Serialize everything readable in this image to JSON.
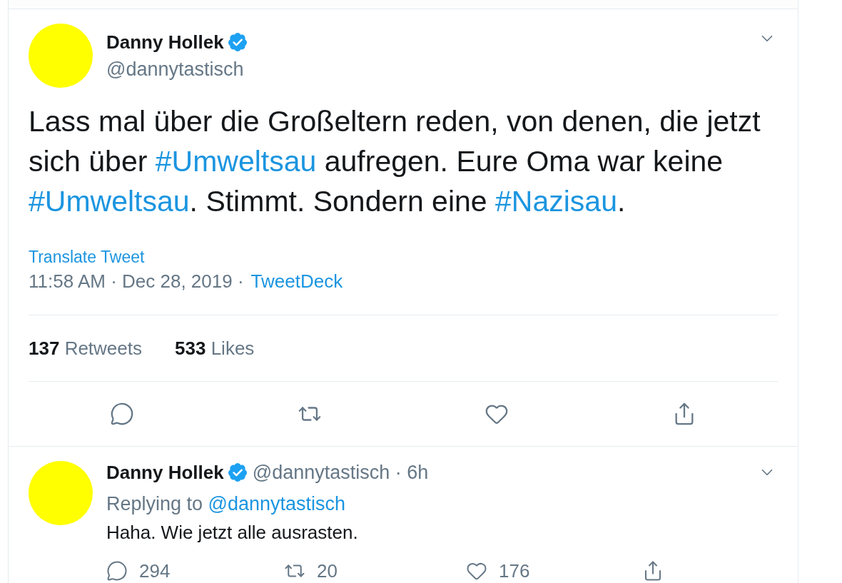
{
  "tweet": {
    "author": {
      "name": "Danny Hollek",
      "verified": true,
      "handle": "@dannytastisch"
    },
    "text": [
      {
        "kind": "plain",
        "text": "Lass mal über die Großeltern reden, von denen, die jetzt sich über "
      },
      {
        "kind": "hashtag",
        "text": "#Umweltsau"
      },
      {
        "kind": "plain",
        "text": " aufregen. Eure Oma war keine "
      },
      {
        "kind": "hashtag",
        "text": "#Umweltsau"
      },
      {
        "kind": "plain",
        "text": ". Stimmt. Sondern eine "
      },
      {
        "kind": "hashtag",
        "text": "#Nazisau"
      },
      {
        "kind": "plain",
        "text": "."
      }
    ],
    "translate": "Translate Tweet",
    "timestamp": "11:58 AM · Dec 28, 2019 ·",
    "source": "TweetDeck",
    "stats": [
      {
        "count": "137",
        "label": "Retweets"
      },
      {
        "count": "533",
        "label": "Likes"
      }
    ],
    "actions": [
      {
        "kind": "reply"
      },
      {
        "kind": "retweet"
      },
      {
        "kind": "like"
      },
      {
        "kind": "share"
      }
    ]
  },
  "reply": {
    "author": {
      "name": "Danny Hollek",
      "verified": true,
      "byline": "@dannytastisch · 6h"
    },
    "replying_to": {
      "label": "Replying to",
      "handle": "@dannytastisch"
    },
    "text": "Haha. Wie jetzt alle ausrasten.",
    "actions": [
      {
        "kind": "reply",
        "count": "294"
      },
      {
        "kind": "retweet",
        "count": "20"
      },
      {
        "kind": "like",
        "count": "176"
      },
      {
        "kind": "share"
      }
    ]
  }
}
